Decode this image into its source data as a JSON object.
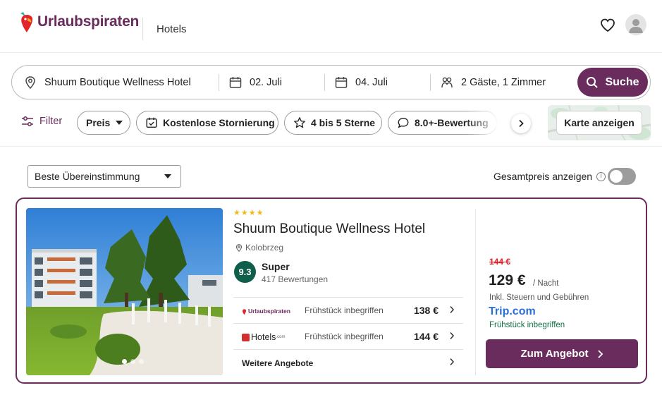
{
  "header": {
    "brand": "Urlaubspiraten",
    "nav_item": "Hotels"
  },
  "search": {
    "hotel": "Shuum Boutique Wellness Hotel",
    "checkin": "02. Juli",
    "checkout": "04. Juli",
    "guests": "2 Gäste, 1 Zimmer",
    "button": "Suche"
  },
  "filters": {
    "filter_label": "Filter",
    "chips": [
      "Preis",
      "Kostenlose Stornierung",
      "4 bis 5 Sterne",
      "8.0+-Bewertung"
    ],
    "map_button": "Karte anzeigen"
  },
  "sort": {
    "selected": "Beste Übereinstimmung",
    "total_price_label": "Gesamtpreis anzeigen",
    "total_price_on": false
  },
  "hotel": {
    "stars": "★★★★",
    "star_count": 4,
    "name": "Shuum Boutique Wellness Hotel",
    "location": "Kolobrzeg",
    "score": "9.3",
    "score_word": "Super",
    "review_count": "417 Bewertungen",
    "image_count": 3,
    "active_image": 1,
    "offers": [
      {
        "provider": "Urlaubspiraten",
        "board": "Frühstück inbegriffen",
        "price": "138 €"
      },
      {
        "provider": "Hotels",
        "provider_suffix": ".com",
        "board": "Frühstück inbegriffen",
        "price": "144 €"
      }
    ],
    "more_offers": "Weitere Angebote",
    "old_price": "144 €",
    "price": "129 €",
    "per_night": "/ Nacht",
    "tax_note": "Inkl. Steuern und Gebühren",
    "best_provider_main": "Trip",
    "best_provider_suffix": ".com",
    "best_board": "Frühstück inbegriffen",
    "cta": "Zum Angebot"
  },
  "colors": {
    "brand": "#6a2c5d",
    "score_bg": "#0f5e4b",
    "old_price": "#e0252b",
    "provider_blue": "#2b6fd6",
    "board_green": "#107040"
  }
}
